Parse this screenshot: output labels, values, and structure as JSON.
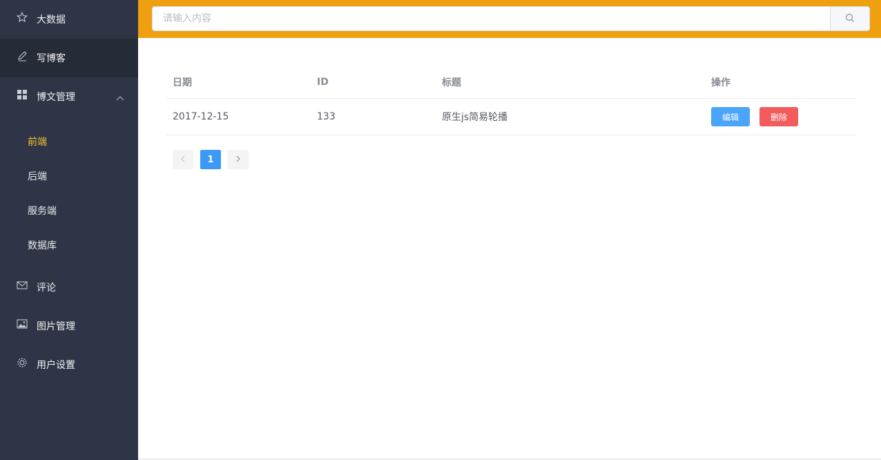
{
  "sidebar": {
    "items": [
      {
        "label": "大数据",
        "icon": "star-icon"
      },
      {
        "label": "写博客",
        "icon": "pencil-icon"
      },
      {
        "label": "博文管理",
        "icon": "grid-icon",
        "submenu": [
          {
            "label": "前端",
            "active": true
          },
          {
            "label": "后端"
          },
          {
            "label": "服务端"
          },
          {
            "label": "数据库"
          }
        ]
      },
      {
        "label": "评论",
        "icon": "mail-icon"
      },
      {
        "label": "图片管理",
        "icon": "picture-icon"
      },
      {
        "label": "用户设置",
        "icon": "gear-icon"
      }
    ]
  },
  "header": {
    "search": {
      "placeholder": "请输入内容",
      "value": ""
    }
  },
  "table": {
    "columns": [
      "日期",
      "ID",
      "标题",
      "操作"
    ],
    "rows": [
      {
        "date": "2017-12-15",
        "id": "133",
        "title": "原生js简易轮播",
        "edit_label": "编辑",
        "delete_label": "删除"
      }
    ]
  },
  "pagination": {
    "current": "1",
    "prev_icon": "chevron-left-icon",
    "next_icon": "chevron-right-icon"
  },
  "colors": {
    "sidebar_bg": "#2f3547",
    "header_bg": "#eea010",
    "active_submenu": "#f5c030",
    "edit_button": "#4aa4f8",
    "delete_button": "#f25c5c",
    "page_current": "#3c99f7"
  }
}
